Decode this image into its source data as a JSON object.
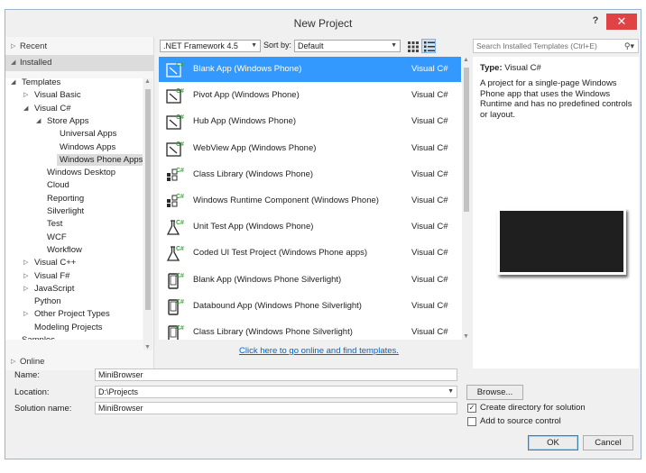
{
  "window": {
    "title": "New Project",
    "help": "?",
    "close": "✕"
  },
  "left": {
    "recent": "Recent",
    "installed": "Installed",
    "online": "Online",
    "tree": [
      {
        "label": "Templates",
        "indent": 0,
        "expander": "open"
      },
      {
        "label": "Visual Basic",
        "indent": 1,
        "expander": "closed"
      },
      {
        "label": "Visual C#",
        "indent": 1,
        "expander": "open"
      },
      {
        "label": "Store Apps",
        "indent": 2,
        "expander": "open"
      },
      {
        "label": "Universal Apps",
        "indent": 3,
        "expander": "none"
      },
      {
        "label": "Windows Apps",
        "indent": 3,
        "expander": "none"
      },
      {
        "label": "Windows Phone Apps",
        "indent": 3,
        "expander": "none",
        "selected": true
      },
      {
        "label": "Windows Desktop",
        "indent": 2,
        "expander": "none"
      },
      {
        "label": "Cloud",
        "indent": 2,
        "expander": "none"
      },
      {
        "label": "Reporting",
        "indent": 2,
        "expander": "none"
      },
      {
        "label": "Silverlight",
        "indent": 2,
        "expander": "none"
      },
      {
        "label": "Test",
        "indent": 2,
        "expander": "none"
      },
      {
        "label": "WCF",
        "indent": 2,
        "expander": "none"
      },
      {
        "label": "Workflow",
        "indent": 2,
        "expander": "none"
      },
      {
        "label": "Visual C++",
        "indent": 1,
        "expander": "closed"
      },
      {
        "label": "Visual F#",
        "indent": 1,
        "expander": "closed"
      },
      {
        "label": "JavaScript",
        "indent": 1,
        "expander": "closed"
      },
      {
        "label": "Python",
        "indent": 1,
        "expander": "none"
      },
      {
        "label": "Other Project Types",
        "indent": 1,
        "expander": "closed"
      },
      {
        "label": "Modeling Projects",
        "indent": 1,
        "expander": "none"
      },
      {
        "label": "Samples",
        "indent": 0,
        "expander": "none"
      }
    ]
  },
  "toolbar": {
    "framework": ".NET Framework 4.5",
    "sort_label": "Sort by:",
    "sort_value": "Default",
    "search_placeholder": "Search Installed Templates (Ctrl+E)"
  },
  "templates": [
    {
      "name": "Blank App (Windows Phone)",
      "lang": "Visual C#",
      "icon": "phone-app-icon",
      "selected": true
    },
    {
      "name": "Pivot App (Windows Phone)",
      "lang": "Visual C#",
      "icon": "phone-app-icon"
    },
    {
      "name": "Hub App (Windows Phone)",
      "lang": "Visual C#",
      "icon": "phone-app-icon"
    },
    {
      "name": "WebView App (Windows Phone)",
      "lang": "Visual C#",
      "icon": "phone-app-icon"
    },
    {
      "name": "Class Library (Windows Phone)",
      "lang": "Visual C#",
      "icon": "class-library-icon"
    },
    {
      "name": "Windows Runtime Component (Windows Phone)",
      "lang": "Visual C#",
      "icon": "class-library-icon"
    },
    {
      "name": "Unit Test App (Windows Phone)",
      "lang": "Visual C#",
      "icon": "test-flask-icon"
    },
    {
      "name": "Coded UI Test Project (Windows Phone apps)",
      "lang": "Visual C#",
      "icon": "test-flask-icon"
    },
    {
      "name": "Blank App (Windows Phone Silverlight)",
      "lang": "Visual C#",
      "icon": "phone-device-icon"
    },
    {
      "name": "Databound App (Windows Phone Silverlight)",
      "lang": "Visual C#",
      "icon": "phone-device-icon"
    },
    {
      "name": "Class Library (Windows Phone Silverlight)",
      "lang": "Visual C#",
      "icon": "phone-device-icon"
    }
  ],
  "online_link": "Click here to go online and find templates.",
  "description": {
    "type_label": "Type:",
    "type_value": "Visual C#",
    "text": "A project for a single-page Windows Phone app that uses the Windows Runtime and has no predefined controls or layout."
  },
  "form": {
    "name_label": "Name:",
    "name_value": "MiniBrowser",
    "location_label": "Location:",
    "location_value": "D:\\Projects",
    "solution_label": "Solution name:",
    "solution_value": "MiniBrowser",
    "browse": "Browse...",
    "create_dir": "Create directory for solution",
    "create_dir_checked": true,
    "add_source": "Add to source control",
    "add_source_checked": false,
    "ok": "OK",
    "cancel": "Cancel"
  },
  "colors": {
    "selection": "#3399ff",
    "close": "#e04343",
    "link": "#0066cc"
  }
}
